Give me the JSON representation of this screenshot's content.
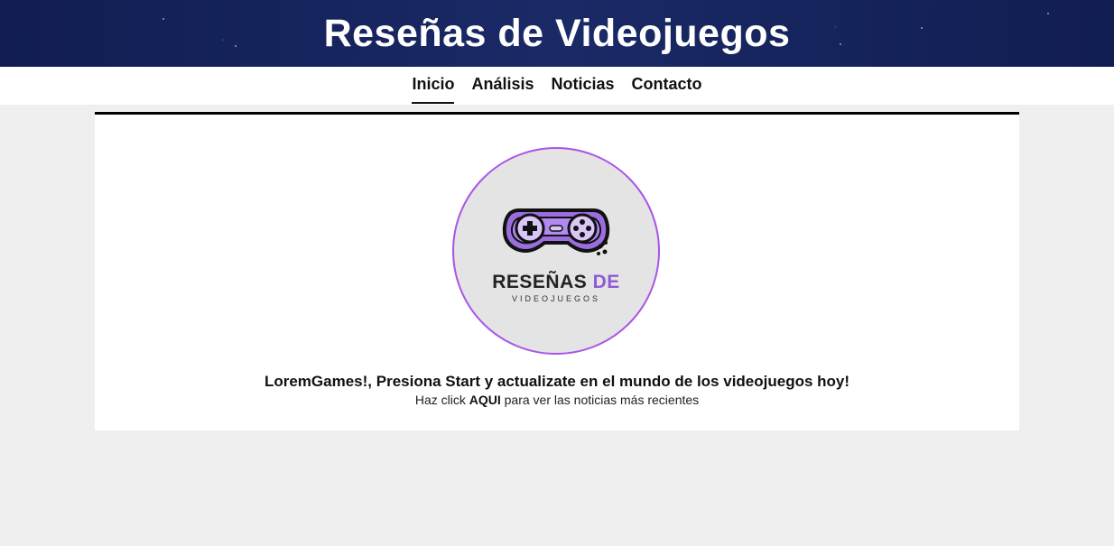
{
  "header": {
    "title": "Reseñas de Videojuegos"
  },
  "nav": {
    "items": [
      {
        "label": "Inicio",
        "active": true
      },
      {
        "label": "Análisis",
        "active": false
      },
      {
        "label": "Noticias",
        "active": false
      },
      {
        "label": "Contacto",
        "active": false
      }
    ]
  },
  "logo": {
    "word1": "RESEÑAS",
    "word2": "DE",
    "word3": "VIDEOJUEGOS",
    "icon": "gamepad-icon",
    "accent": "#8e5bd6"
  },
  "main": {
    "tagline": "LoremGames!, Presiona Start y actualizate en el mundo de los videojuegos hoy!",
    "sub_before": "Haz click",
    "sub_link": "AQUI",
    "sub_after": "para ver las noticias más recientes"
  },
  "colors": {
    "banner": "#14215a",
    "page_bg": "#efefef",
    "logo_border": "#a855e8"
  }
}
